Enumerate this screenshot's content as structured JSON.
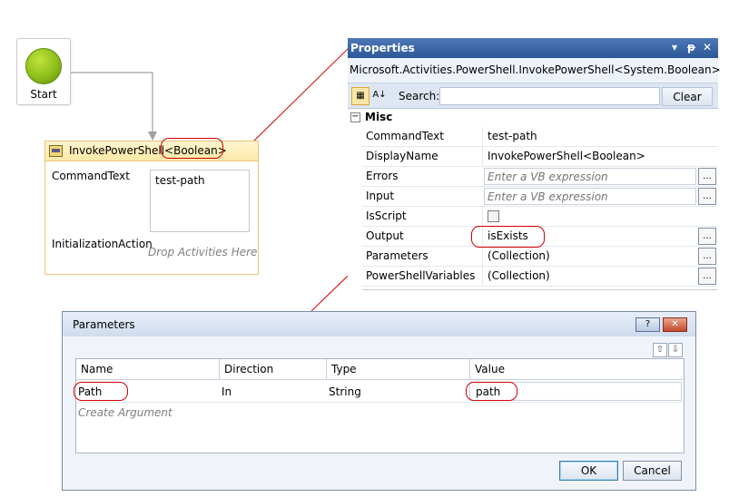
{
  "designer": {
    "start_label": "Start",
    "activity": {
      "title": "InvokePowerShell",
      "type_arg": "<Boolean>",
      "command_label": "CommandText",
      "command_value": "test-path",
      "init_label": "InitializationAction",
      "drop_hint": "Drop Activities Here"
    }
  },
  "properties": {
    "title": "Properties",
    "controls": [
      "▾",
      "ᵽ",
      "✕"
    ],
    "type_name": "Microsoft.Activities.PowerShell.InvokePowerShell<System.Boolean>",
    "toolbar": {
      "categorized_icon": "categorized-icon",
      "alpha_icon": "sort-alpha-icon",
      "search_label": "Search:",
      "search_value": "",
      "clear_label": "Clear"
    },
    "category": "Misc",
    "category_toggle": "−",
    "rows": [
      {
        "name": "CommandText",
        "value": "test-path"
      },
      {
        "name": "DisplayName",
        "value": "InvokePowerShell<Boolean>"
      },
      {
        "name": "Errors",
        "placeholder": "Enter a VB expression",
        "button": "..."
      },
      {
        "name": "Input",
        "placeholder": "Enter a VB expression",
        "button": "..."
      },
      {
        "name": "IsScript",
        "checked": false
      },
      {
        "name": "Output",
        "value": "isExists",
        "button": "..."
      },
      {
        "name": "Parameters",
        "value": "(Collection)",
        "button": "..."
      },
      {
        "name": "PowerShellVariables",
        "value": "(Collection)",
        "button": "..."
      }
    ]
  },
  "dialog": {
    "title": "Parameters",
    "help_label": "?",
    "close_label": "✕",
    "move_up": "⇧",
    "move_down": "⇩",
    "columns": [
      "Name",
      "Direction",
      "Type",
      "Value"
    ],
    "rows": [
      {
        "name": "Path",
        "direction": "In",
        "type": "String",
        "value": "path"
      }
    ],
    "create_argument": "Create Argument",
    "ok_label": "OK",
    "cancel_label": "Cancel"
  },
  "colors": {
    "annotation": "#d40000",
    "title_bar": "#2d5898",
    "activity_header": "#fde9a8"
  }
}
